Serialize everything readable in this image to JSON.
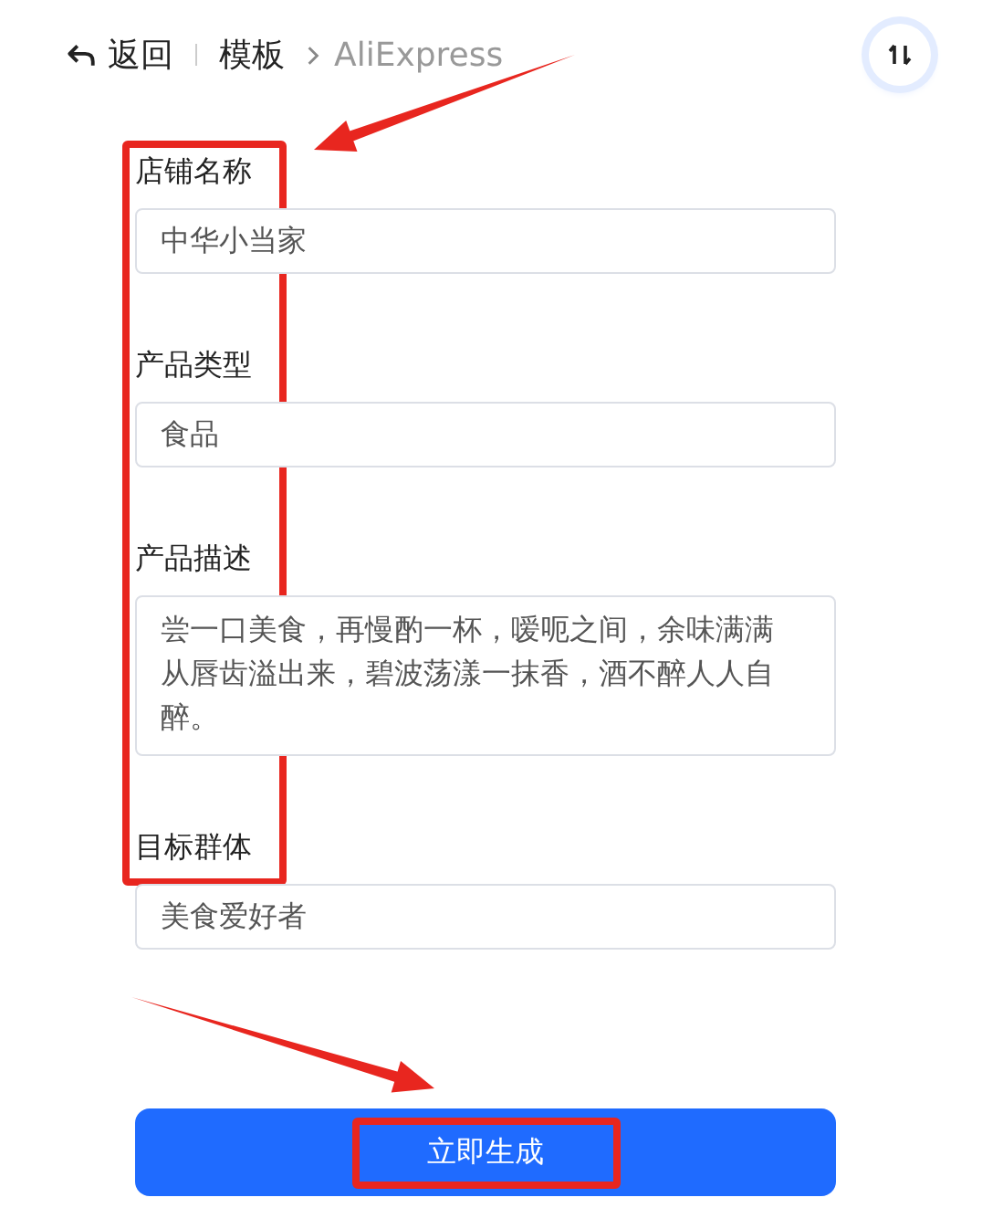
{
  "breadcrumb": {
    "back": "返回",
    "section": "模板",
    "current": "AliExpress"
  },
  "fields": [
    {
      "label": "店铺名称",
      "kind": "line",
      "value": "中华小当家"
    },
    {
      "label": "产品类型",
      "kind": "line",
      "value": "食品"
    },
    {
      "label": "产品描述",
      "kind": "multiline",
      "value": "尝一口美食，再慢酌一杯，嗳呃之间，余味满满从唇齿溢出来，碧波荡漾一抹香，酒不醉人人自醉。"
    },
    {
      "label": "目标群体",
      "kind": "line",
      "value": "美食爱好者"
    }
  ],
  "submit": "立即生成",
  "annotations": [
    {
      "kind": "box"
    },
    {
      "kind": "arrow"
    },
    {
      "kind": "arrow"
    },
    {
      "kind": "box"
    }
  ]
}
